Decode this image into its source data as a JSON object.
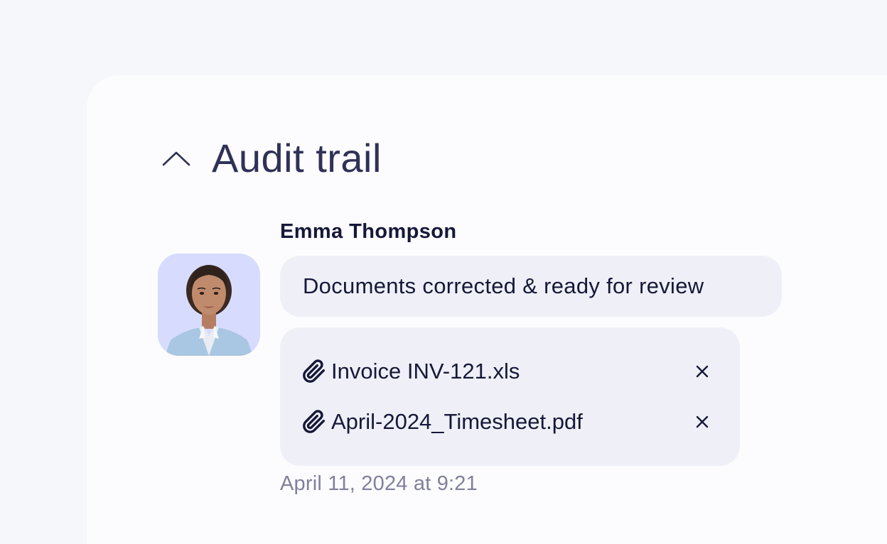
{
  "section": {
    "title": "Audit trail",
    "collapse_icon": "chevron-up-icon"
  },
  "entry": {
    "author": "Emma Thompson",
    "message": "Documents corrected & ready for review",
    "attachments": [
      {
        "name": "Invoice INV-121.xls",
        "icon": "paperclip-icon",
        "remove_icon": "close-icon"
      },
      {
        "name": "April-2024_Timesheet.pdf",
        "icon": "paperclip-icon",
        "remove_icon": "close-icon"
      }
    ],
    "timestamp": "April 11, 2024 at 9:21"
  },
  "colors": {
    "page_background": "#f6f7fa",
    "panel_background": "#fcfcfe",
    "bubble_background": "#eff0f7",
    "avatar_background": "#d7dcff",
    "title_text": "#2f3157",
    "body_text": "#151838",
    "muted_text": "#80809c"
  }
}
